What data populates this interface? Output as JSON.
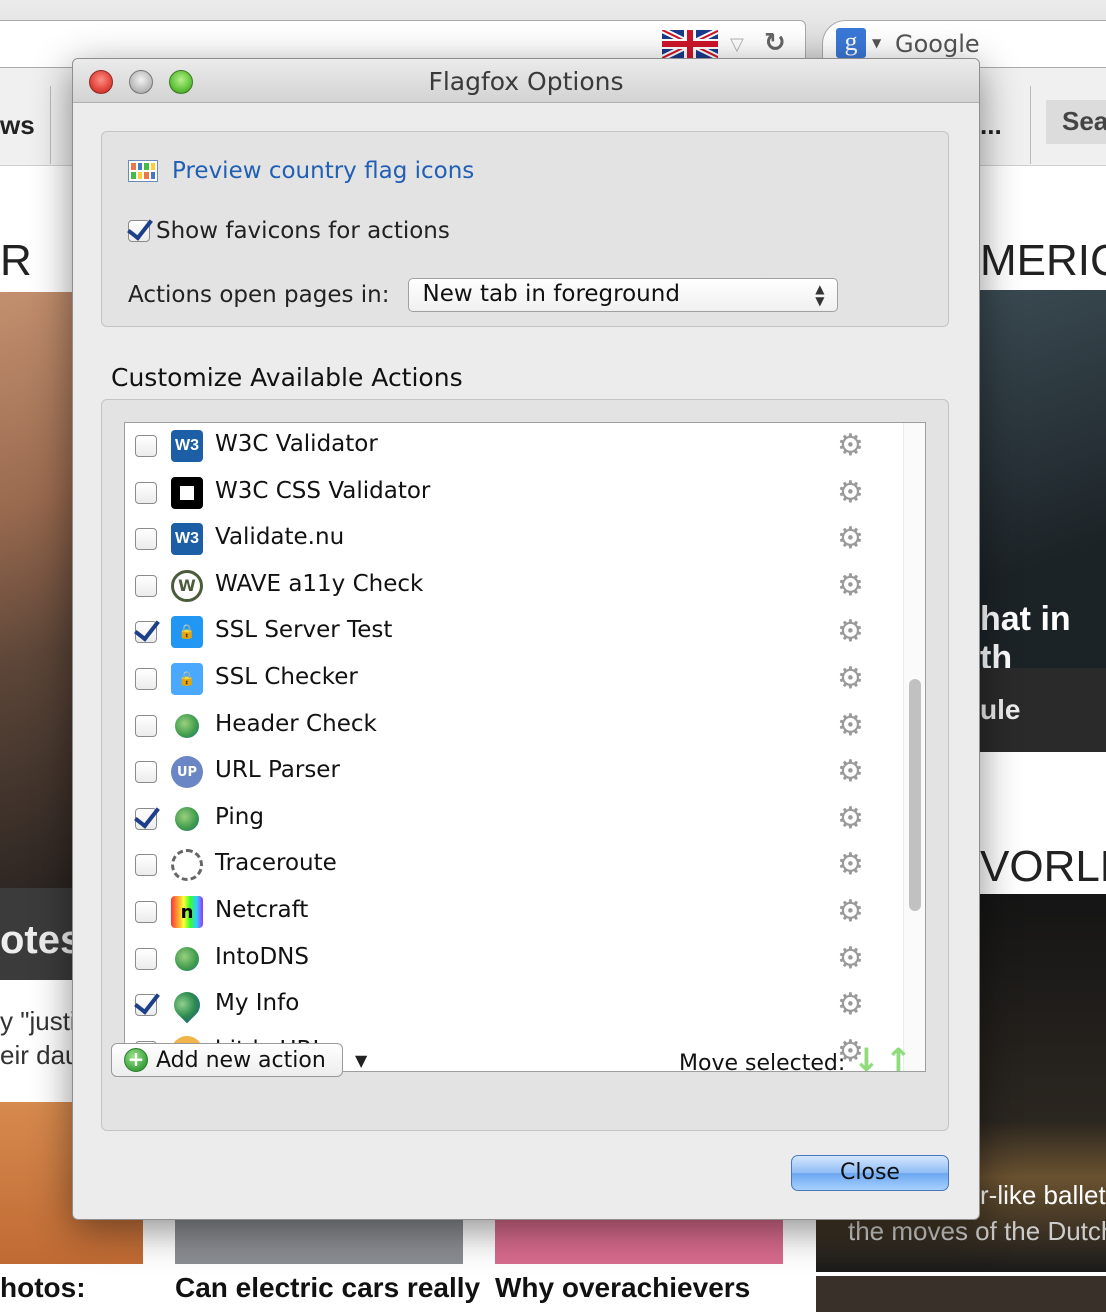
{
  "browser": {
    "search_placeholder": "Google",
    "search_engine_badge": "g",
    "bookmarks_left": "ws",
    "bookmarks_overflow": "...",
    "bookmarks_search": "Sea"
  },
  "background": {
    "left_letter": "R",
    "left_caption": "otes",
    "left_snippet_1": "y \"justi",
    "left_snippet_2": "eir dau",
    "right_heading_1": "MERIC",
    "right_overlay": "hat in th",
    "right_bar": "ule",
    "right_heading_2": "VORLD",
    "right_caption_1": "r-like ballet",
    "right_caption_2": "the moves of the Dutch",
    "headlines": [
      "hotos:",
      "Can electric cars really",
      "Why overachievers"
    ]
  },
  "dialog": {
    "title": "Flagfox Options",
    "preview_link": "Preview country flag icons",
    "show_favicons_label": "Show favicons for actions",
    "show_favicons_checked": true,
    "open_pages_label": "Actions open pages in:",
    "open_pages_value": "New tab in foreground",
    "section_title": "Customize Available Actions",
    "actions": [
      {
        "name": "W3C Validator",
        "checked": false,
        "icon": "w3c-icon"
      },
      {
        "name": "W3C CSS Validator",
        "checked": false,
        "icon": "css-validator-icon"
      },
      {
        "name": "Validate.nu",
        "checked": false,
        "icon": "w3c-icon"
      },
      {
        "name": "WAVE a11y Check",
        "checked": false,
        "icon": "wave-icon"
      },
      {
        "name": "SSL Server Test",
        "checked": true,
        "icon": "lock-icon"
      },
      {
        "name": "SSL Checker",
        "checked": false,
        "icon": "lock-icon"
      },
      {
        "name": "Header Check",
        "checked": false,
        "icon": "globe-icon"
      },
      {
        "name": "URL Parser",
        "checked": false,
        "icon": "url-parser-icon"
      },
      {
        "name": "Ping",
        "checked": true,
        "icon": "globe-icon"
      },
      {
        "name": "Traceroute",
        "checked": false,
        "icon": "traceroute-icon"
      },
      {
        "name": "Netcraft",
        "checked": false,
        "icon": "netcraft-icon"
      },
      {
        "name": "IntoDNS",
        "checked": false,
        "icon": "globe-icon"
      },
      {
        "name": "My Info",
        "checked": true,
        "icon": "map-pin-icon"
      },
      {
        "name": "bit.ly URL",
        "checked": false,
        "icon": "bitly-icon"
      }
    ],
    "add_action_label": "Add new action",
    "move_selected_label": "Move selected:",
    "close_label": "Close"
  },
  "colors": {
    "link": "#1f5fb5",
    "checkmark": "#1d3f8a",
    "move_arrows": "#8fdc7b",
    "close_button": "#6ba7f0"
  }
}
